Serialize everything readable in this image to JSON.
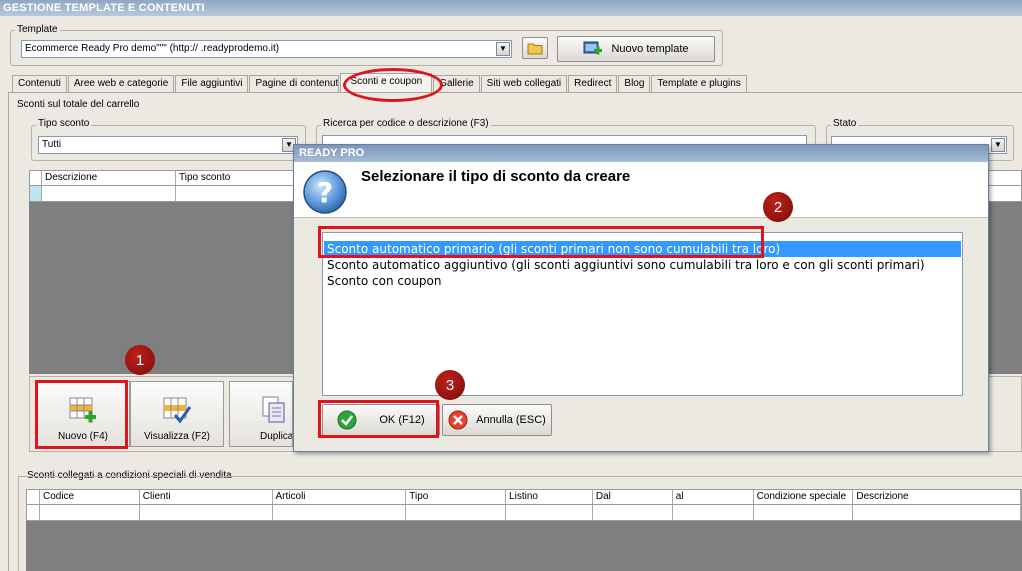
{
  "window": {
    "title": "GESTIONE TEMPLATE E CONTENUTI"
  },
  "template_group": {
    "label": "Template",
    "selected_value": "Ecommerce Ready Pro demo\"\"\" (http://     .readyprodemo.it)",
    "new_button": "Nuovo template"
  },
  "tabs": [
    "Contenuti",
    "Aree web e categorie",
    "File aggiuntivi",
    "Pagine di contenuti",
    "Sconti e coupon",
    "Gallerie",
    "Siti web collegati",
    "Redirect",
    "Blog",
    "Template e plugins"
  ],
  "active_tab": "Sconti e coupon",
  "cart_discounts": {
    "label": "Sconti sul totale del carrello",
    "tipo_label": "Tipo sconto",
    "tipo_value": "Tutti",
    "search_label": "Ricerca per codice o descrizione (F3)",
    "search_value": "",
    "stato_label": "Stato",
    "columns": [
      "Descrizione",
      "Tipo sconto"
    ]
  },
  "toolbar": {
    "nuovo": "Nuovo (F4)",
    "visualizza": "Visualizza (F2)",
    "duplica": "Duplica"
  },
  "linked_discounts": {
    "label": "Sconti collegati a condizioni speciali di vendita",
    "columns": [
      "Codice",
      "Clienti",
      "Articoli",
      "Tipo",
      "Listino",
      "Dal",
      "al",
      "Condizione speciale",
      "Descrizione"
    ]
  },
  "dialog": {
    "title": "READY PRO",
    "heading": "Selezionare il tipo di sconto da creare",
    "options": [
      "Sconto automatico primario (gli sconti primari non sono cumulabili tra loro)",
      "Sconto automatico aggiuntivo (gli sconti aggiuntivi sono cumulabili tra loro e con gli sconti primari)",
      "Sconto con coupon"
    ],
    "selected_index": 0,
    "ok_button": "OK (F12)",
    "cancel_button": "Annulla (ESC)"
  },
  "annotations": {
    "badges": [
      "1",
      "2",
      "3"
    ]
  },
  "colors": {
    "highlight_red": "#e0141e",
    "selection_blue": "#3399ff",
    "title_blue": "#7c96bb"
  }
}
